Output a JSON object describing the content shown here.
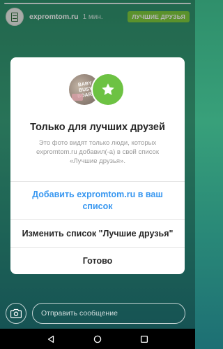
{
  "story": {
    "username": "expromtom.ru",
    "time": "1 мин.",
    "close_friends_badge": "ЛУЧШИЕ ДРУЗЬЯ"
  },
  "dialog": {
    "photo_text": "BABY BUSY BOARD",
    "title": "Только для лучших друзей",
    "description": "Это фото видят только люди, которых expromtom.ru добавил(-а) в свой список «Лучшие друзья».",
    "add_label": "Добавить expromtom.ru в ваш список",
    "edit_label": "Изменить список \"Лучшие друзья\"",
    "done_label": "Готово"
  },
  "reply": {
    "placeholder": "Отправить сообщение"
  },
  "colors": {
    "accent_blue": "#3897f0",
    "close_friends_green": "#6dc243",
    "badge_green": "#7ecb3d"
  },
  "icons": [
    "document-icon",
    "star-icon",
    "camera-icon",
    "back-icon",
    "home-icon",
    "recents-icon"
  ]
}
